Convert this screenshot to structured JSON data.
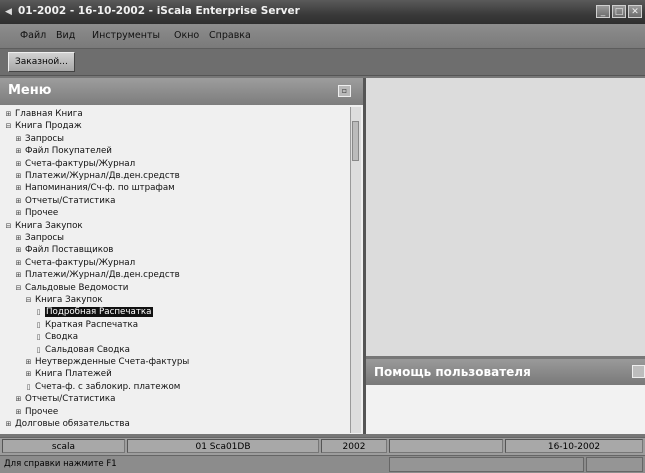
{
  "window": {
    "title": "01-2002 - 16-10-2002 - iScala Enterprise Server"
  },
  "menubar": {
    "items": [
      "Файл",
      "Вид",
      "Инструменты",
      "Окно",
      "Справка"
    ]
  },
  "toolbar": {
    "button_label": "Заказной..."
  },
  "menu_panel": {
    "title": "Меню",
    "tree": [
      {
        "label": "Главная Книга",
        "level": 0,
        "icon": "expander-plus-icon"
      },
      {
        "label": "Книга Продаж",
        "level": 0,
        "icon": "expander-minus-icon"
      },
      {
        "label": "Запросы",
        "level": 1,
        "icon": "expander-plus-icon"
      },
      {
        "label": "Файл Покупателей",
        "level": 1,
        "icon": "expander-plus-icon"
      },
      {
        "label": "Счета-фактуры/Журнал",
        "level": 1,
        "icon": "expander-plus-icon"
      },
      {
        "label": "Платежи/Журнал/Дв.ден.средств",
        "level": 1,
        "icon": "expander-plus-icon"
      },
      {
        "label": "Напоминания/Сч-ф. по штрафам",
        "level": 1,
        "icon": "expander-plus-icon"
      },
      {
        "label": "Отчеты/Статистика",
        "level": 1,
        "icon": "expander-plus-icon"
      },
      {
        "label": "Прочее",
        "level": 1,
        "icon": "expander-plus-icon"
      },
      {
        "label": "Книга Закупок",
        "level": 0,
        "icon": "expander-minus-icon"
      },
      {
        "label": "Запросы",
        "level": 1,
        "icon": "expander-plus-icon"
      },
      {
        "label": "Файл Поставщиков",
        "level": 1,
        "icon": "expander-plus-icon"
      },
      {
        "label": "Счета-фактуры/Журнал",
        "level": 1,
        "icon": "expander-plus-icon"
      },
      {
        "label": "Платежи/Журнал/Дв.ден.средств",
        "level": 1,
        "icon": "expander-plus-icon"
      },
      {
        "label": "Сальдовые Ведомости",
        "level": 1,
        "icon": "expander-minus-icon"
      },
      {
        "label": "Книга Закупок",
        "level": 2,
        "icon": "expander-minus-icon"
      },
      {
        "label": "Подробная Распечатка",
        "level": 3,
        "icon": "document-icon",
        "selected": true
      },
      {
        "label": "Краткая Распечатка",
        "level": 3,
        "icon": "document-icon"
      },
      {
        "label": "Сводка",
        "level": 3,
        "icon": "document-icon"
      },
      {
        "label": "Сальдовая Сводка",
        "level": 3,
        "icon": "document-icon"
      },
      {
        "label": "Неутвержденные Счета-фактуры",
        "level": 2,
        "icon": "expander-plus-icon"
      },
      {
        "label": "Книга Платежей",
        "level": 2,
        "icon": "expander-plus-icon"
      },
      {
        "label": "Счета-ф. с заблокир. платежом",
        "level": 2,
        "icon": "document-icon"
      },
      {
        "label": "Отчеты/Статистика",
        "level": 1,
        "icon": "expander-plus-icon"
      },
      {
        "label": "Прочее",
        "level": 1,
        "icon": "expander-plus-icon"
      },
      {
        "label": "Долговые обязательства",
        "level": 0,
        "icon": "expander-plus-icon"
      }
    ]
  },
  "help_panel": {
    "title": "Помощь пользователя"
  },
  "statusbar": {
    "user": "scala",
    "company": "01 Sca01DB",
    "year": "2002",
    "date": "16-10-2002"
  },
  "hintbar": {
    "text": "Для справки нажмите F1"
  }
}
